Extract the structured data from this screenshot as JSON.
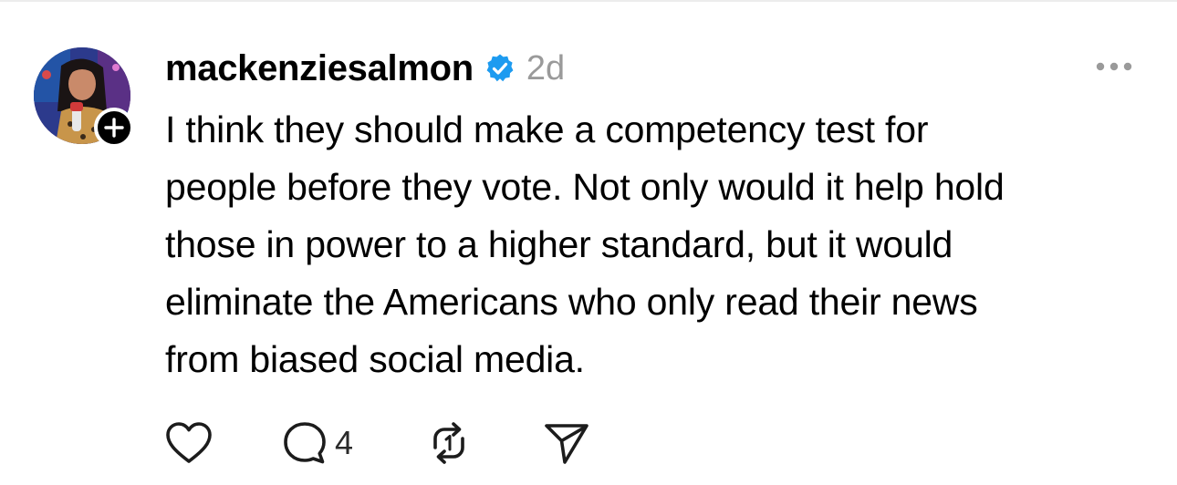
{
  "post": {
    "username": "mackenziesalmon",
    "verified": true,
    "timestamp": "2d",
    "body_lines": [
      "I think they should make a competency test for",
      "people before they vote. Not only would it help hold",
      "those in power to a higher standard, but it would",
      "eliminate the Americans who only read their news",
      "from biased social media."
    ],
    "reply_count": "4"
  },
  "icons": {
    "more": "more-horizontal-icon",
    "like": "heart-icon",
    "reply": "comment-bubble-icon",
    "repost": "repost-arrows-icon",
    "share": "send-paper-plane-icon",
    "verified": "verified-badge-icon",
    "follow": "plus-icon"
  },
  "colors": {
    "verified_blue": "#1d9bf0",
    "timestamp_gray": "#9a9a9a",
    "icon_dark": "#1c1c1c"
  }
}
